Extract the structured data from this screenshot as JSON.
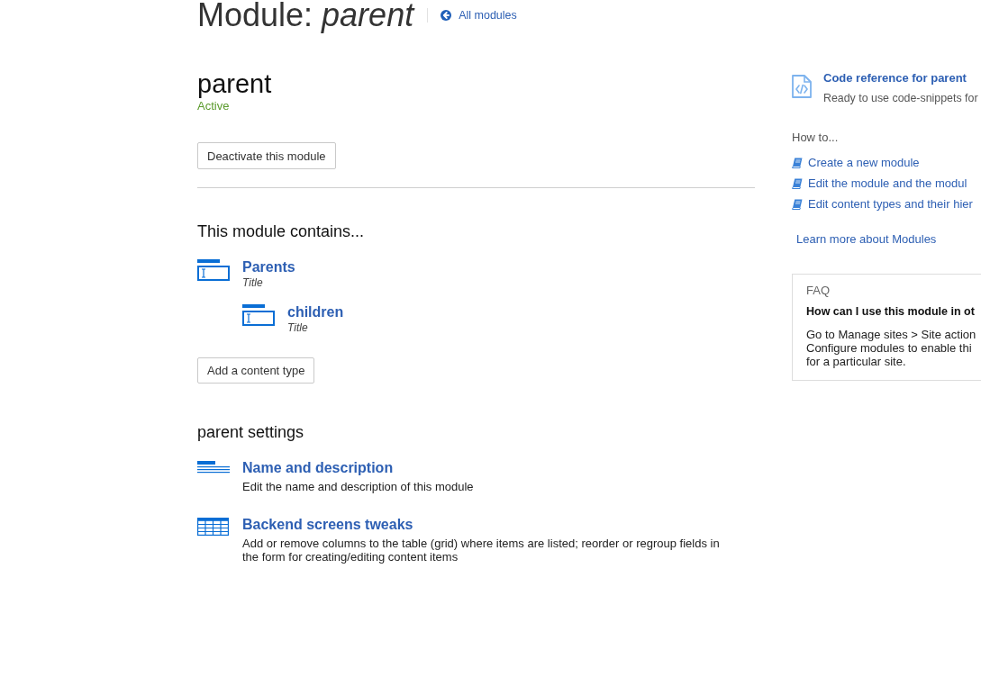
{
  "header": {
    "title": "Module: *parent*",
    "back_link": "All modules"
  },
  "module": {
    "name": "parent",
    "status": "Active",
    "action_button": "Deactivate this module"
  },
  "contents": {
    "heading": "This module contains...",
    "content_types": [
      {
        "name": "Parents",
        "title_field": "Title",
        "children": [
          {
            "name": "children",
            "title_field": "Title"
          }
        ]
      }
    ],
    "add_button": "Add a content type"
  },
  "settings": {
    "heading": "parent settings",
    "items": [
      {
        "kind": "form",
        "title": "Name and description",
        "description": "Edit the name and description of this module"
      },
      {
        "kind": "grid",
        "title": "Backend screens tweaks",
        "description": "Add or remove columns to the table (grid) where items are listed; reorder or regroup fields in the form for creating/editing content items"
      }
    ]
  },
  "sidebar": {
    "code_reference": {
      "title": "Code reference for parent",
      "description": "Ready to use code-snippets for"
    },
    "how_to": {
      "heading": "How to...",
      "links": [
        "Create a new module",
        "Edit the module and the modul",
        "Edit content types and their hier"
      ]
    },
    "learn_more": "Learn more about Modules",
    "faq": {
      "heading": "FAQ",
      "question": "How can I use this module in ot",
      "answer_lines": [
        "Go to Manage sites > Site action",
        "Configure modules to enable thi",
        "for a particular site."
      ]
    }
  }
}
